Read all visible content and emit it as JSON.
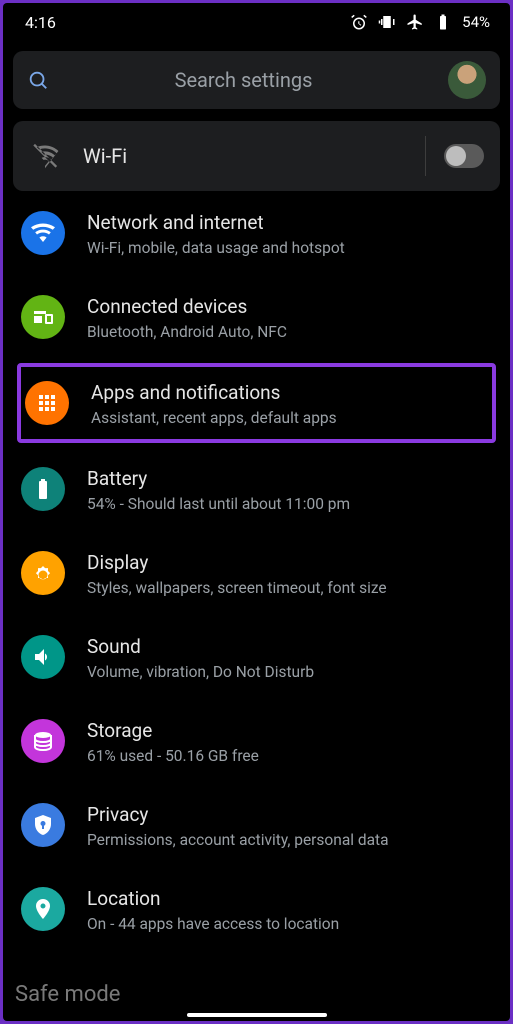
{
  "status": {
    "time": "4:16",
    "battery_pct": "54%"
  },
  "search": {
    "placeholder": "Search settings"
  },
  "wifi": {
    "label": "Wi-Fi",
    "on": false
  },
  "items": [
    {
      "title": "Network and internet",
      "subtitle": "Wi-Fi, mobile, data usage and hotspot",
      "icon": "wifi",
      "color": "bg-blue1",
      "highlight": false
    },
    {
      "title": "Connected devices",
      "subtitle": "Bluetooth, Android Auto, NFC",
      "icon": "devices",
      "color": "bg-green1",
      "highlight": false
    },
    {
      "title": "Apps and notifications",
      "subtitle": "Assistant, recent apps, default apps",
      "icon": "apps",
      "color": "bg-orange",
      "highlight": true
    },
    {
      "title": "Battery",
      "subtitle": "54% - Should last until about 11:00 pm",
      "icon": "battery",
      "color": "bg-teal",
      "highlight": false
    },
    {
      "title": "Display",
      "subtitle": "Styles, wallpapers, screen timeout, font size",
      "icon": "brightness",
      "color": "bg-amber",
      "highlight": false
    },
    {
      "title": "Sound",
      "subtitle": "Volume, vibration, Do Not Disturb",
      "icon": "sound",
      "color": "bg-teal2",
      "highlight": false
    },
    {
      "title": "Storage",
      "subtitle": "61% used - 50.16 GB free",
      "icon": "storage",
      "color": "bg-magenta",
      "highlight": false
    },
    {
      "title": "Privacy",
      "subtitle": "Permissions, account activity, personal data",
      "icon": "privacy",
      "color": "bg-bluep",
      "highlight": false
    },
    {
      "title": "Location",
      "subtitle": "On - 44 apps have access to location",
      "icon": "location",
      "color": "bg-cyan",
      "highlight": false
    }
  ],
  "safe_mode_label": "Safe mode"
}
